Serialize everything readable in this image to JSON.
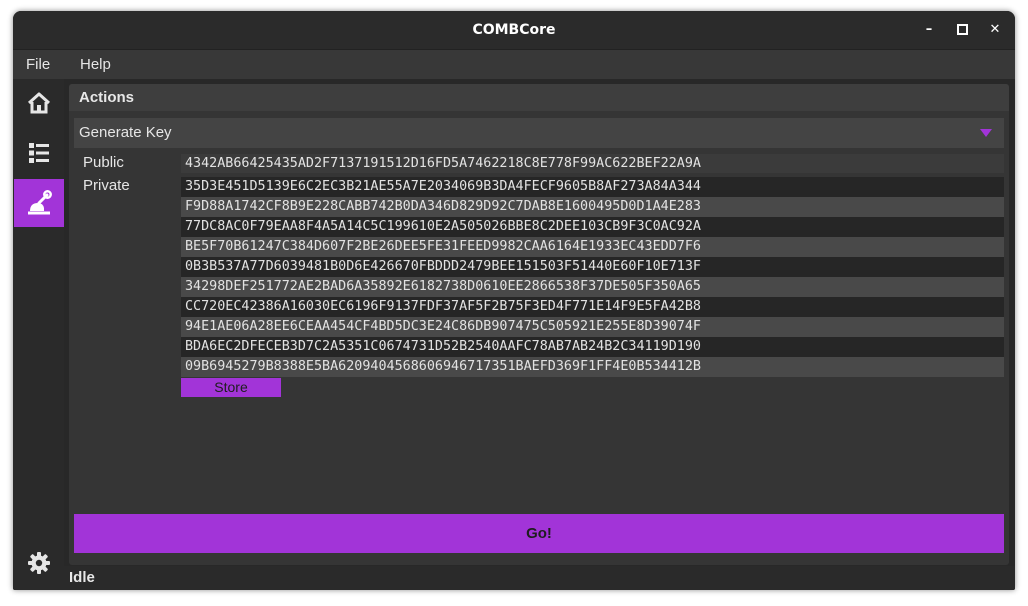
{
  "window": {
    "title": "COMBCore"
  },
  "window_controls": {
    "minimize": "–",
    "maximize": "□",
    "close": "✕"
  },
  "menu": {
    "items": [
      "File",
      "Help"
    ]
  },
  "sidebar": {
    "items": [
      {
        "icon": "home-icon"
      },
      {
        "icon": "list-icon"
      },
      {
        "icon": "tools-icon",
        "active": true
      }
    ],
    "bottom_icon": "gear-icon"
  },
  "colors": {
    "accent": "#a234d8",
    "background": "#2f2f2f",
    "panel": "#353535"
  },
  "panel": {
    "title": "Actions",
    "action_select": {
      "selected": "Generate Key"
    },
    "public_label": "Public",
    "public_key": "4342AB66425435AD2F7137191512D16FD5A7462218C8E778F99AC622BEF22A9A",
    "private_label": "Private",
    "private_key": [
      "35D3E451D5139E6C2EC3B21AE55A7E2034069B3DA4FECF9605B8AF273A84A344",
      "F9D88A1742CF8B9E228CABB742B0DA346D829D92C7DAB8E1600495D0D1A4E283",
      "77DC8AC0F79EAA8F4A5A14C5C199610E2A505026BBE8C2DEE103CB9F3C0AC92A",
      "BE5F70B61247C384D607F2BE26DEE5FE31FEED9982CAA6164E1933EC43EDD7F6",
      "0B3B537A77D6039481B0D6E426670FBDDD2479BEE151503F51440E60F10E713F",
      "34298DEF251772AE2BAD6A35892E6182738D0610EE2866538F37DE505F350A65",
      "CC720EC42386A16030EC6196F9137FDF37AF5F2B75F3ED4F771E14F9E5FA42B8",
      "94E1AE06A28EE6CEAA454CF4BD5DC3E24C86DB907475C505921E255E8D39074F",
      "BDA6EC2DFECEB3D7C2A5351C0674731D52B2540AAFC78AB7AB24B2C34119D190",
      "09B6945279B8388E5BA6209404568606946717351BAEFD369F1FF4E0B534412B"
    ],
    "store_label": "Store",
    "go_label": "Go!"
  },
  "status": {
    "text": "Idle"
  }
}
